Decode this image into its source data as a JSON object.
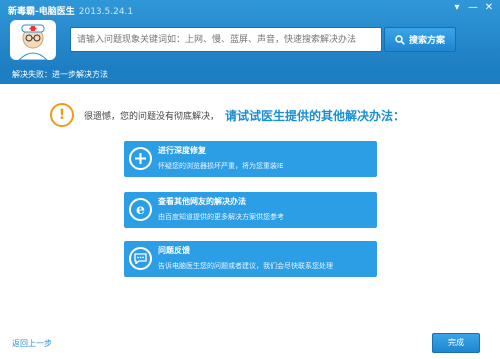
{
  "window": {
    "title": "新毒霸-电脑医生",
    "version": "2013.5.24.1",
    "controls": [
      "▾",
      "—",
      "✕"
    ]
  },
  "search": {
    "placeholder": "请输入问题现象关键词如：上网、慢、蓝屏、声音，快速搜索解决办法",
    "button_label": "搜索方案"
  },
  "breadcrumb": "解决失败：进一步解决方法",
  "notice": {
    "text": "很遗憾，您的问题没有彻底解决，",
    "highlight": "请试试医生提供的其他解决办法："
  },
  "options": [
    {
      "icon": "plus-icon",
      "title": "进行深度修复",
      "desc": "怀疑您的浏览器损坏严重，将为您重装IE"
    },
    {
      "icon": "ie-icon",
      "title": "查看其他网友的解决办法",
      "desc": "由百度知道提供的更多解决方案供您参考"
    },
    {
      "icon": "chat-icon",
      "title": "问题反馈",
      "desc": "告诉电脑医生您的问题或者建议，我们会尽快联系您处理"
    }
  ],
  "footer": {
    "back_label": "返回上一步",
    "finish_label": "完成"
  },
  "colors": {
    "header_blue": "#1f7fc2",
    "option_blue": "#2c9ee6",
    "warning_orange": "#f39a1c",
    "highlight_blue": "#1a8fd6"
  }
}
